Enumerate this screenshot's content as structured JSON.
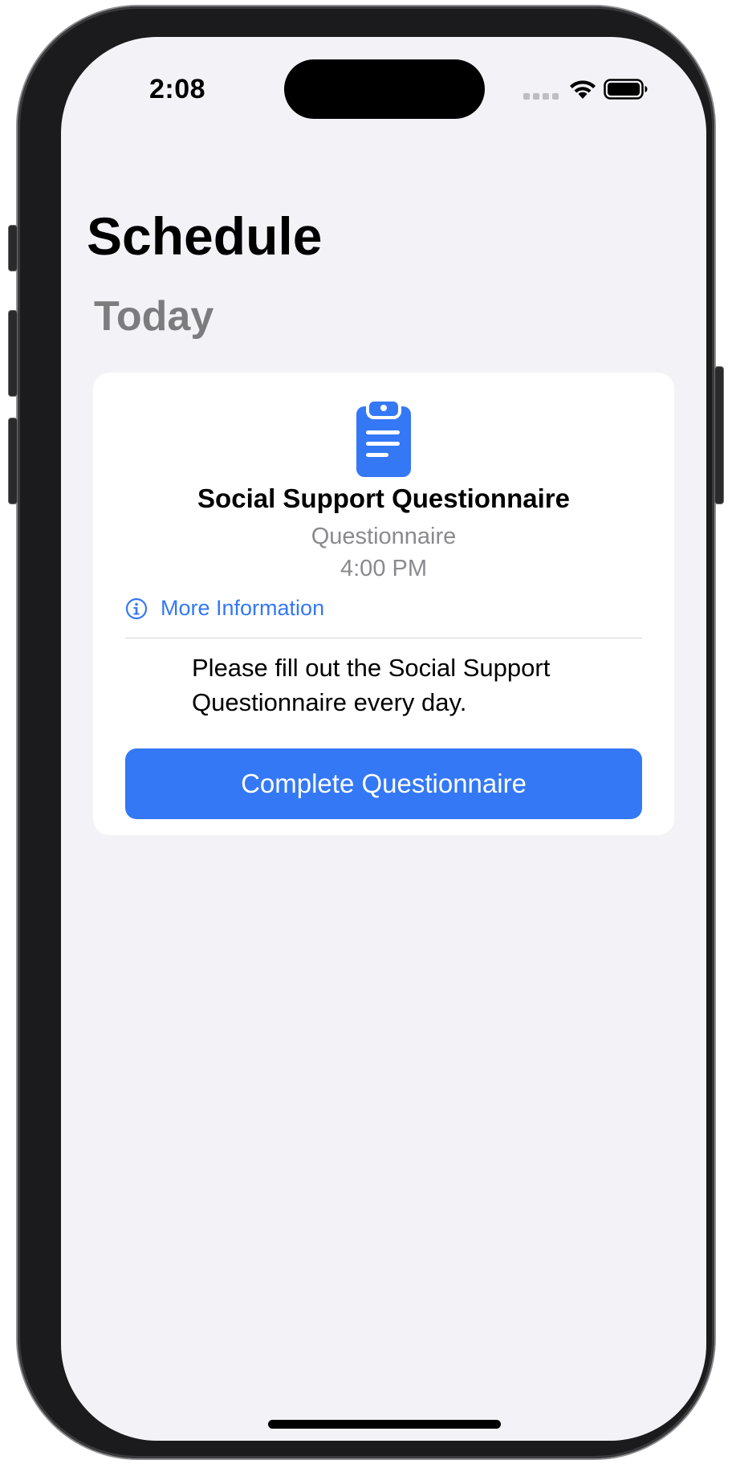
{
  "status_bar": {
    "time": "2:08",
    "icons": [
      "signal-icon",
      "wifi-icon",
      "battery-icon"
    ]
  },
  "header": {
    "title": "Schedule"
  },
  "section": {
    "title": "Today"
  },
  "task_card": {
    "icon": "clipboard-icon",
    "title": "Social Support Questionnaire",
    "type": "Questionnaire",
    "time": "4:00 PM",
    "more_info_icon": "info-circle-icon",
    "more_info_label": "More Information",
    "instructions": "Please fill out the Social Support Questionnaire every day.",
    "action_label": "Complete Questionnaire"
  },
  "colors": {
    "accent": "#3478f6",
    "background": "#f2f2f7",
    "card": "#ffffff",
    "secondary_text": "#8a8a8e",
    "section_title": "#7c7c7f"
  }
}
